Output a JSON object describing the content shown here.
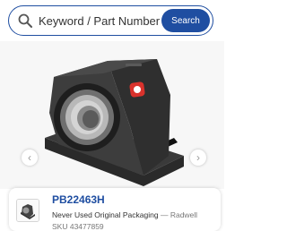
{
  "search": {
    "placeholder": "Keyword / Part Number / SKU",
    "button_label": "Search"
  },
  "gallery": {
    "prev_arrow": "‹",
    "next_arrow": "›",
    "image_icon": "bearing-product-photo"
  },
  "product": {
    "part_number": "PB22463H",
    "condition": "Never Used Original Packaging",
    "seller_separator": " — ",
    "seller": "Radwell",
    "sku": "SKU 43477859"
  },
  "colors": {
    "brand_blue": "#1f4ea1",
    "badge_red": "#d9322c"
  }
}
